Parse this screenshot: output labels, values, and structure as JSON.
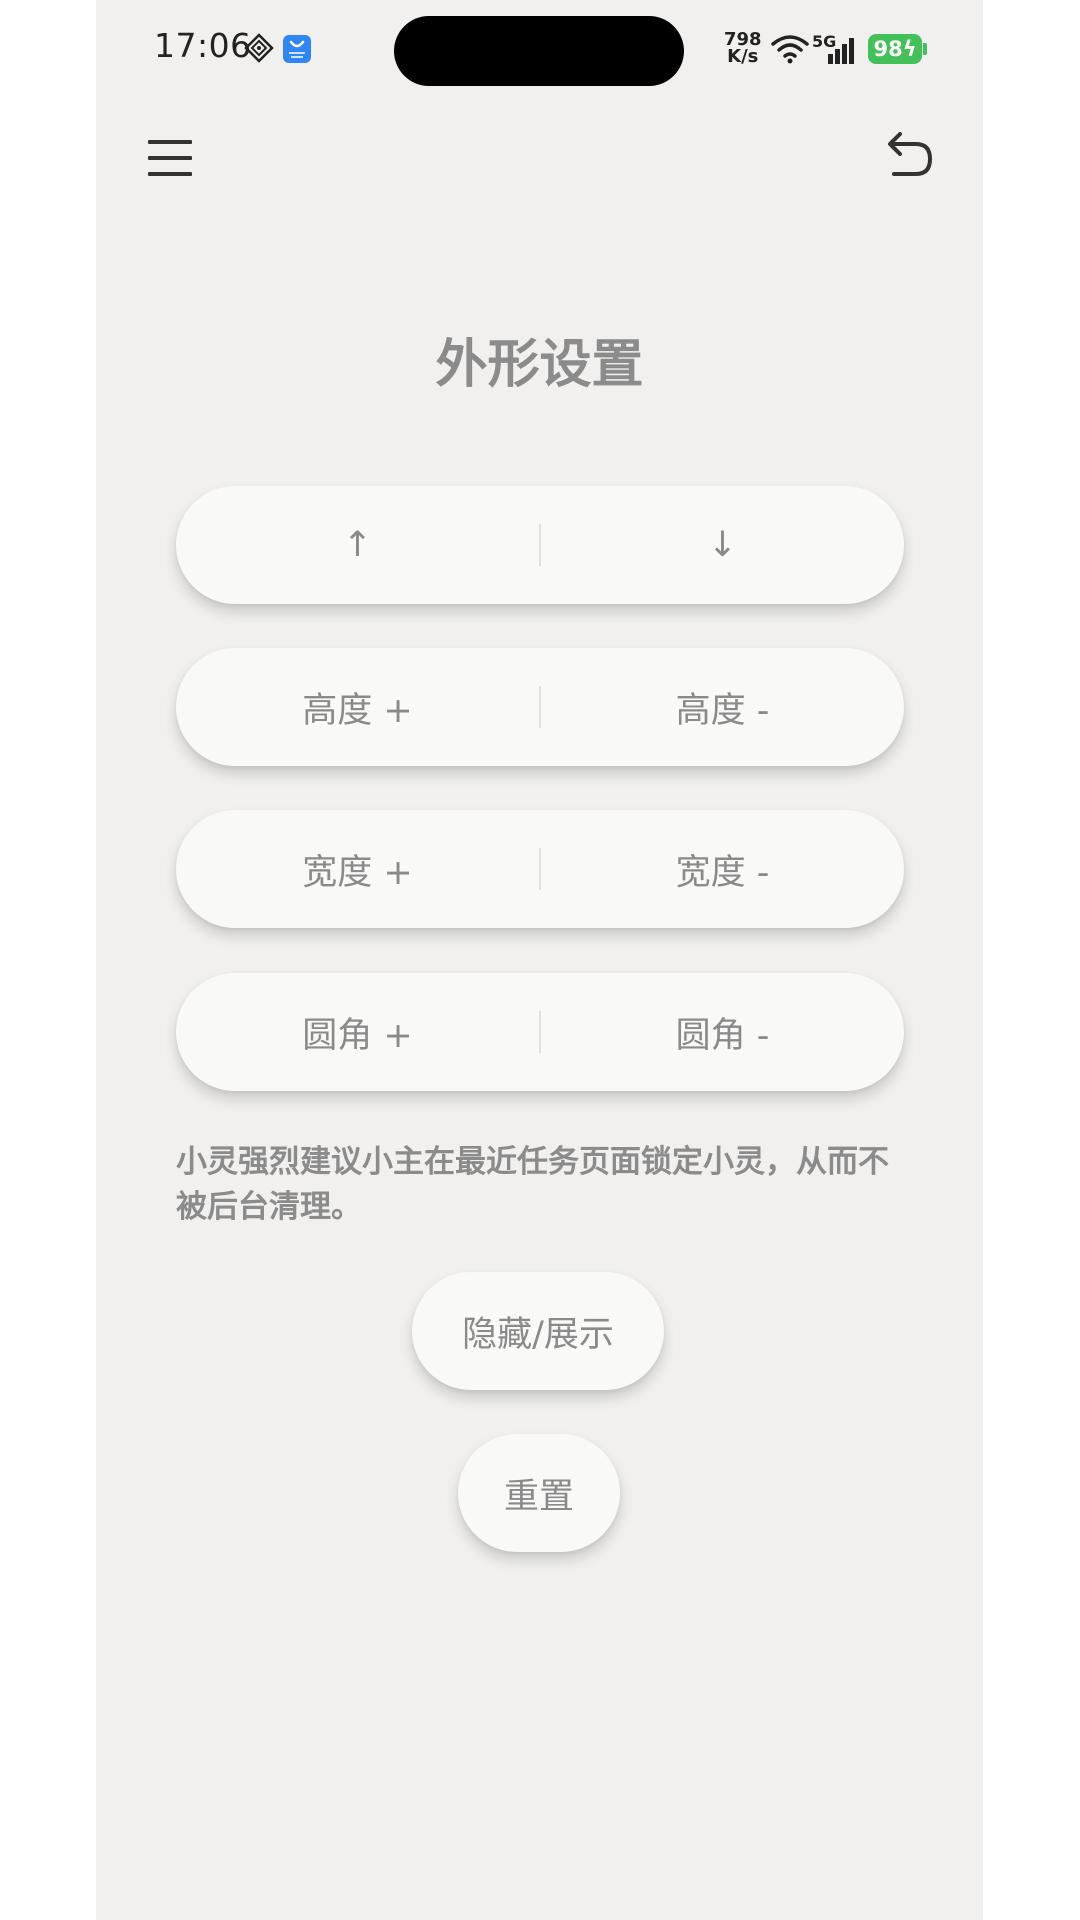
{
  "status_bar": {
    "time": "17:06",
    "network_speed_value": "798",
    "network_speed_unit": "K/s",
    "network_type": "5G",
    "battery": "98"
  },
  "header": {
    "title": "外形设置"
  },
  "controls": {
    "move_up_label": "↑",
    "move_down_label": "↓",
    "height_plus_label": "高度 +",
    "height_minus_label": "高度 -",
    "width_plus_label": "宽度 +",
    "width_minus_label": "宽度 -",
    "radius_plus_label": "圆角 +",
    "radius_minus_label": "圆角 -"
  },
  "hint_text": "小灵强烈建议小主在最近任务页面锁定小灵，从而不被后台清理。",
  "actions": {
    "toggle_label": "隐藏/展示",
    "reset_label": "重置"
  },
  "colors": {
    "background": "#f1f0ef",
    "button_bg": "#f9f9f8",
    "text_gray": "#8a8a8a",
    "battery_green": "#43c159"
  }
}
